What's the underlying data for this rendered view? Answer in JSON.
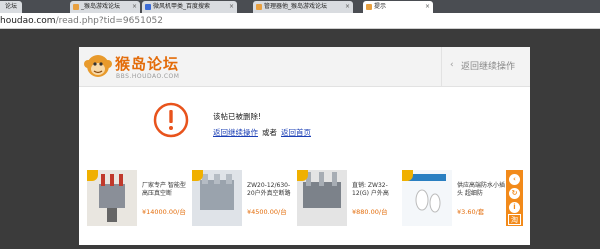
{
  "browser": {
    "tabs": [
      {
        "label": "论坛",
        "active": false,
        "favicon_color": "#e8a040"
      },
      {
        "label": "_猴岛游戏论坛",
        "active": false,
        "favicon_color": "#e8a040"
      },
      {
        "label": "微风机甲类_百度搜索",
        "active": false,
        "favicon_color": "#3b6bd6"
      },
      {
        "label": "管理器他_猴岛游戏论坛",
        "active": false,
        "favicon_color": "#e8a040"
      },
      {
        "label": "提示",
        "active": true,
        "favicon_color": "#e8a040"
      }
    ],
    "address": {
      "host": "houdao.com",
      "path": "/read.php?tid=9651052"
    }
  },
  "site": {
    "logo_text": "猴岛论坛",
    "logo_sub": "BBS.HOUDAO.COM",
    "back_action": "返回继续操作"
  },
  "message": {
    "text": "该帖已被删除!",
    "link_continue": "返回继续操作",
    "or_text": "或者",
    "link_home": "返回首页"
  },
  "ads": [
    {
      "title": "厂家专产 智能型高压真空断",
      "price": "¥14000.00/台"
    },
    {
      "title": "ZW20-12/630-20户外真空断路",
      "price": "¥4500.00/台"
    },
    {
      "title": "直销: ZW32-12(G) 户外高",
      "price": "¥880.00/台"
    },
    {
      "title": "供应高端防水小插头 超细防",
      "price": "¥3.60/套"
    }
  ],
  "ad_side": {
    "taobao": "淘"
  },
  "colors": {
    "accent": "#e36c0a",
    "link": "#1b3fb5",
    "alert": "#e8531c"
  }
}
